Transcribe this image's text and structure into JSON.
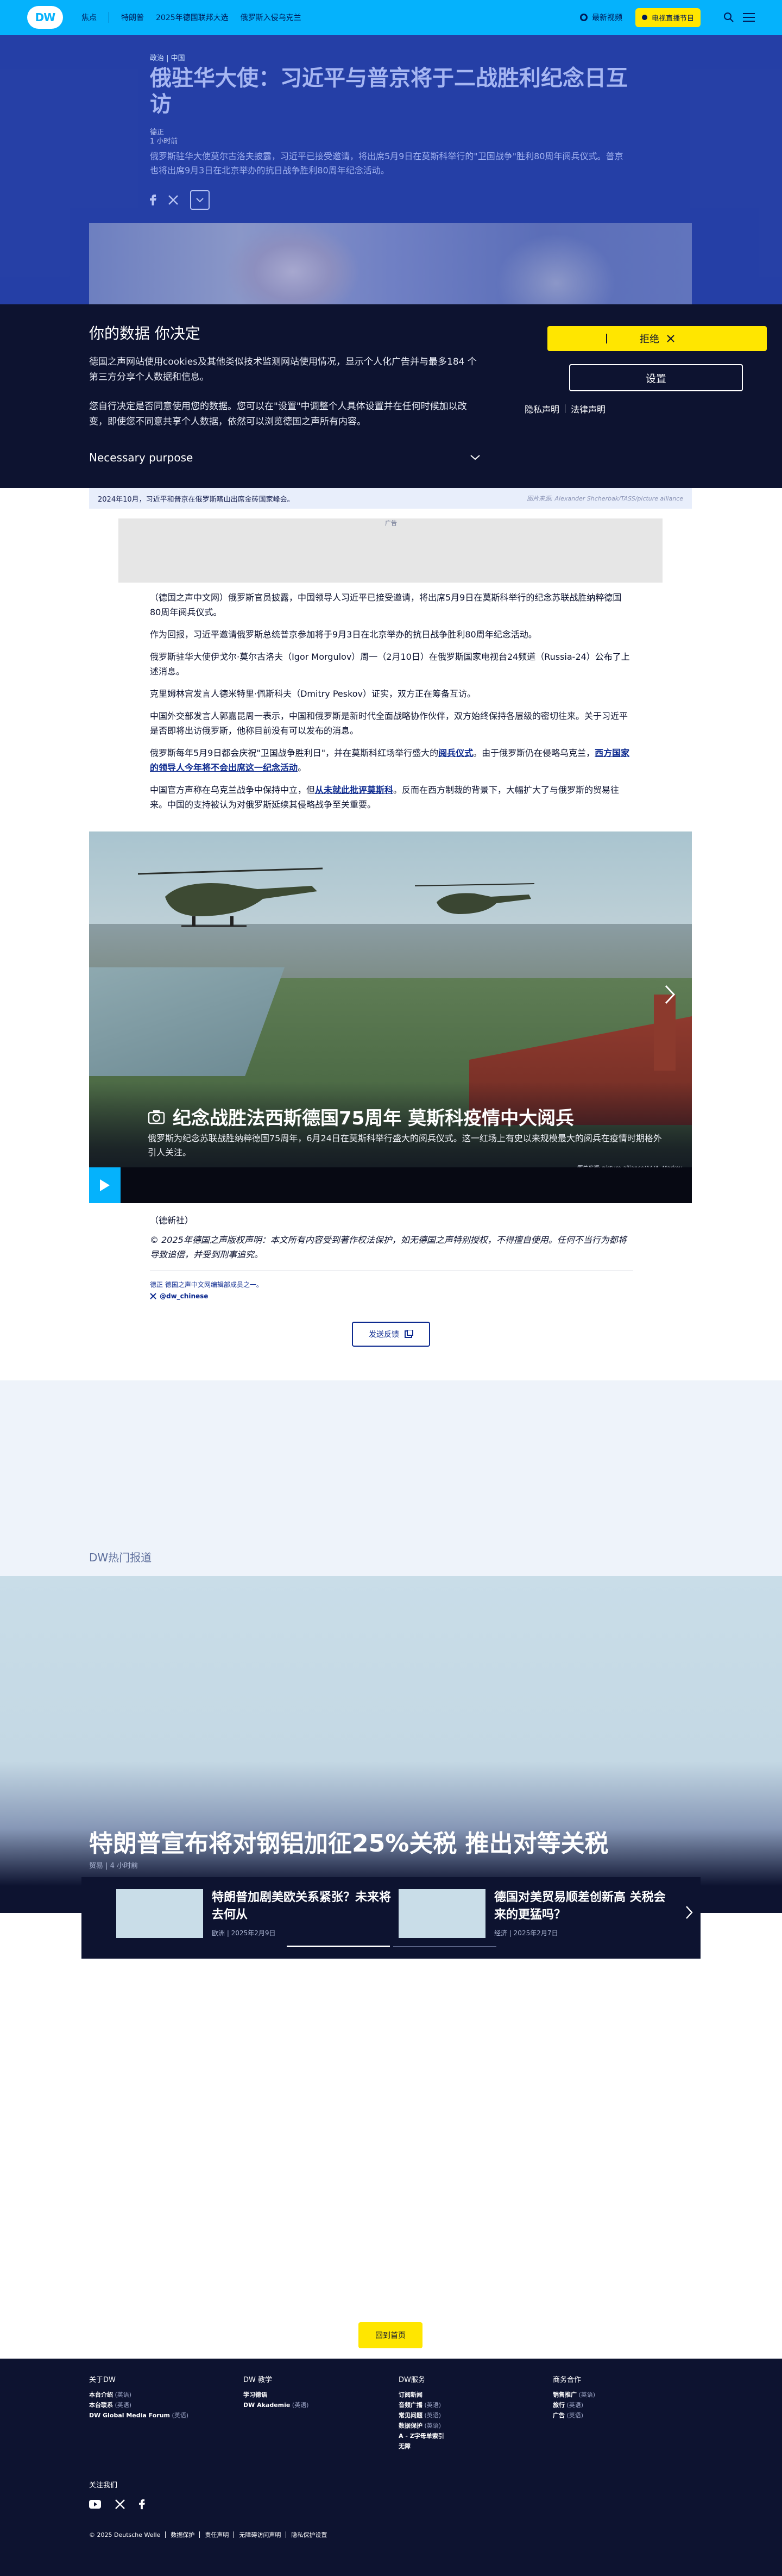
{
  "topbar": {
    "logo": "DW",
    "nav_home": "焦点",
    "nav_items": [
      "特朗普",
      "2025年德国联邦大选",
      "俄罗斯入侵乌克兰"
    ],
    "live_label": "最新视频",
    "tv_label": "电视直播节目"
  },
  "article": {
    "breadcrumb": "政治 | 中国",
    "title": "俄驻华大使：习近平与普京将于二战胜利纪念日互访",
    "author": "德正",
    "time": "1 小时前",
    "lead": "俄罗斯驻华大使莫尔古洛夫披露，习近平已接受邀请，将出席5月9日在莫斯科举行的\"卫国战争\"胜利80周年阅兵仪式。普京也将出席9月3日在北京举办的抗日战争胜利80周年纪念活动。",
    "image_caption": "2024年10月，习近平和普京在俄罗斯喀山出席金砖国家峰会。",
    "image_credit": "图片来源: Alexander Shcherbak/TASS/picture alliance",
    "ad_label": "广告",
    "paragraphs": [
      "（德国之声中文网）俄罗斯官员披露，中国领导人习近平已接受邀请，将出席5月9日在莫斯科举行的纪念苏联战胜纳粹德国80周年阅兵仪式。",
      "作为回报，习近平邀请俄罗斯总统普京参加将于9月3日在北京举办的抗日战争胜利80周年纪念活动。",
      "俄罗斯驻华大使伊戈尔·莫尔古洛夫（Igor Morgulov）周一（2月10日）在俄罗斯国家电视台24频道（Russia-24）公布了上述消息。",
      "克里姆林宫发言人德米特里·佩斯科夫（Dmitry Peskov）证实，双方正在筹备互访。",
      "中国外交部发言人郭嘉昆周一表示，中国和俄罗斯是新时代全面战略协作伙伴，双方始终保持各层级的密切往来。关于习近平是否即将出访俄罗斯，他称目前没有可以发布的消息。"
    ],
    "p6_a": "俄罗斯每年5月9日都会庆祝\"卫国战争胜利日\"，并在莫斯科红场举行盛大的",
    "p6_link1": "阅兵仪式",
    "p6_b": "。由于俄罗斯仍在侵略乌克兰，",
    "p6_link2": "西方国家的领导人今年将不会出席这一纪念活动",
    "p6_c": "。",
    "p7_a": "中国官方声称在乌克兰战争中保持中立，但",
    "p7_link": "从未就此批评莫斯科",
    "p7_b": "。反而在西方制裁的背景下，大幅扩大了与俄罗斯的贸易往来。中国的支持被认为对俄罗斯延续其侵略战争至关重要。",
    "gallery_title": "纪念战胜法西斯德国75周年 莫斯科疫情中大阅兵",
    "gallery_desc": "俄罗斯为纪念苏联战胜纳粹德国75周年，6月24日在莫斯科举行盛大的阅兵仪式。这一红场上有史以来规模最大的阅兵在疫情时期格外引人关注。",
    "gallery_credit": "图片来源: picture-alliance/AA/A. Markov",
    "source": "（德新社）",
    "copyright": "© 2025年德国之声版权声明：本文所有内容受到著作权法保护，如无德国之声特别授权，不得擅自使用。任何不当行为都将导致追偿，并受到刑事追究。",
    "note": "德正 德国之声中文网编辑部成员之一。",
    "handle": "@dw_chinese",
    "feedback": "发送反馈"
  },
  "cookie": {
    "title": "你的数据 你决定",
    "p1": "德国之声网站使用cookies及其他类似技术监测网站使用情况，显示个人化广告并与最多184 个第三方分享个人数据和信息。",
    "p2": "您自行决定是否同意使用您的数据。您可以在\"设置\"中调整个人具体设置并在任何时候加以改变，即使您不同意共享个人数据，依然可以浏览德国之声所有内容。",
    "purpose": "Necessary purpose",
    "reject": "拒绝",
    "settings": "设置",
    "privacy": "隐私声明",
    "legal": "法律声明"
  },
  "hot": {
    "label": "DW热门报道",
    "feature_title": "特朗普宣布将对钢铝加征25%关税 推出对等关税",
    "feature_meta": "贸易 | 4 小时前",
    "cards": [
      {
        "title": "特朗普加剧美欧关系紧张？未来将去何从",
        "meta": "欧洲 | 2025年2月9日"
      },
      {
        "title": "德国对美贸易顺差创新高 关税会来的更猛吗？",
        "meta": "经济 | 2025年2月7日"
      }
    ]
  },
  "back_to_top": "回到首页",
  "footer": {
    "cols": [
      {
        "head": "关于DW",
        "items": [
          [
            "本台介绍",
            "(英语)"
          ],
          [
            "本台联系",
            "(英语)"
          ],
          [
            "DW Global Media Forum",
            "(英语)"
          ]
        ]
      },
      {
        "head": "DW 教学",
        "items": [
          [
            "学习德语",
            ""
          ],
          [
            "DW Akademie",
            "(英语)"
          ]
        ]
      },
      {
        "head": "DW服务",
        "items": [
          [
            "订阅新闻",
            ""
          ],
          [
            "音频广播",
            "(英语)"
          ],
          [
            "常见问题",
            "(英语)"
          ],
          [
            "数据保护",
            "(英语)"
          ],
          [
            "A - Z字母单索引",
            ""
          ],
          [
            "无障",
            ""
          ]
        ]
      },
      {
        "head": "商务合作",
        "items": [
          [
            "销售推广",
            "(英语)"
          ],
          [
            "旅行",
            "(英语)"
          ],
          [
            "广告",
            "(英语)"
          ]
        ]
      }
    ],
    "follow": "关注我们",
    "legal": [
      "© 2025 Deutsche Welle",
      "数据保护",
      "责任声明",
      "无障碍访问声明",
      "隐私保护设置"
    ]
  },
  "colors": {
    "brand": "#05b2fc",
    "accent": "#ffe600",
    "dark": "#0d1330",
    "link": "#0d2a8f"
  }
}
